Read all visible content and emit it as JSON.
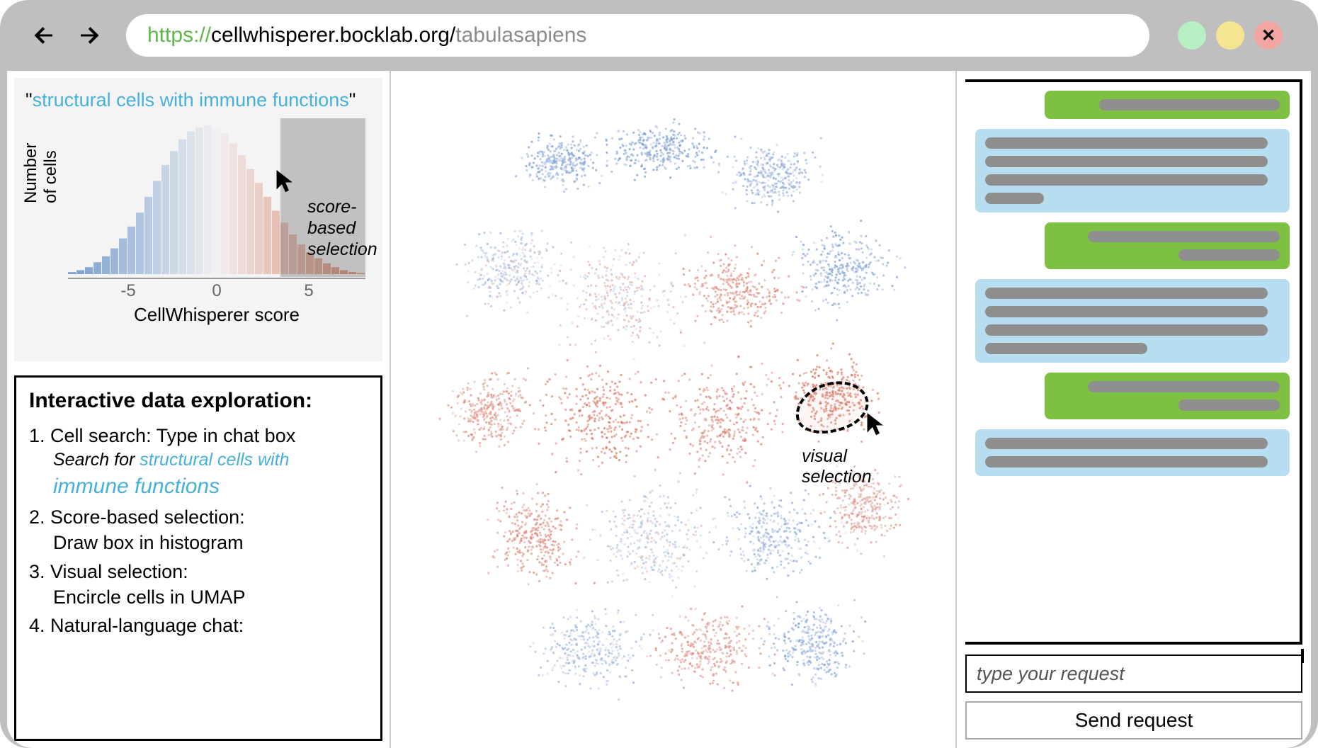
{
  "url": {
    "protocol": "https://",
    "domain": "cellwhisperer.bocklab.org/",
    "path": "tabulasapiens"
  },
  "window_controls": {
    "close_glyph": "✕"
  },
  "left": {
    "query_prefix": "\"",
    "query_text": "structural cells with immune functions",
    "query_suffix": "\"",
    "y_label": "Number\nof cells",
    "x_label": "CellWhisperer score",
    "ticks": {
      "n5": "-5",
      "z": "0",
      "p5": "5"
    },
    "selection_label_l1": "score-based",
    "selection_label_l2": "selection"
  },
  "info": {
    "title": "Interactive data exploration:",
    "step1": "1. Cell search: Type in chat box",
    "step1_sub_prefix": "Search for ",
    "step1_sub_hl1": "structural cells with",
    "step1_sub_hl2": "immune functions",
    "step2a": "2. Score-based selection:",
    "step2b": "Draw box in histogram",
    "step3a": "3. Visual selection:",
    "step3b": "Encircle cells in UMAP",
    "step4": "4. Natural-language chat:"
  },
  "center": {
    "visual_label_l1": "visual",
    "visual_label_l2": "selection"
  },
  "chat": {
    "placeholder": "type your request",
    "send_label": "Send request"
  },
  "chart_data": {
    "type": "bar",
    "title": "",
    "xlabel": "CellWhisperer score",
    "ylabel": "Number of cells",
    "categories": [
      -9,
      -8.5,
      -8,
      -7.5,
      -7,
      -6.5,
      -6,
      -5.5,
      -5,
      -4.5,
      -4,
      -3.5,
      -3,
      -2.5,
      -2,
      -1.5,
      -1,
      -0.5,
      0,
      0.5,
      1,
      1.5,
      2,
      2.5,
      3,
      3.5,
      4,
      4.5,
      5,
      5.5,
      6,
      6.5,
      7,
      7.5,
      8
    ],
    "values": [
      2,
      4,
      7,
      12,
      18,
      26,
      36,
      48,
      62,
      78,
      94,
      110,
      124,
      136,
      144,
      148,
      150,
      148,
      142,
      132,
      120,
      106,
      92,
      78,
      64,
      52,
      40,
      30,
      22,
      16,
      11,
      7,
      4,
      2,
      1
    ],
    "xlim": [
      -9,
      8
    ],
    "x_ticks": [
      -5,
      0,
      5
    ],
    "selection_range": [
      4,
      8
    ],
    "color_scale": "blue-to-red diverging on x"
  }
}
